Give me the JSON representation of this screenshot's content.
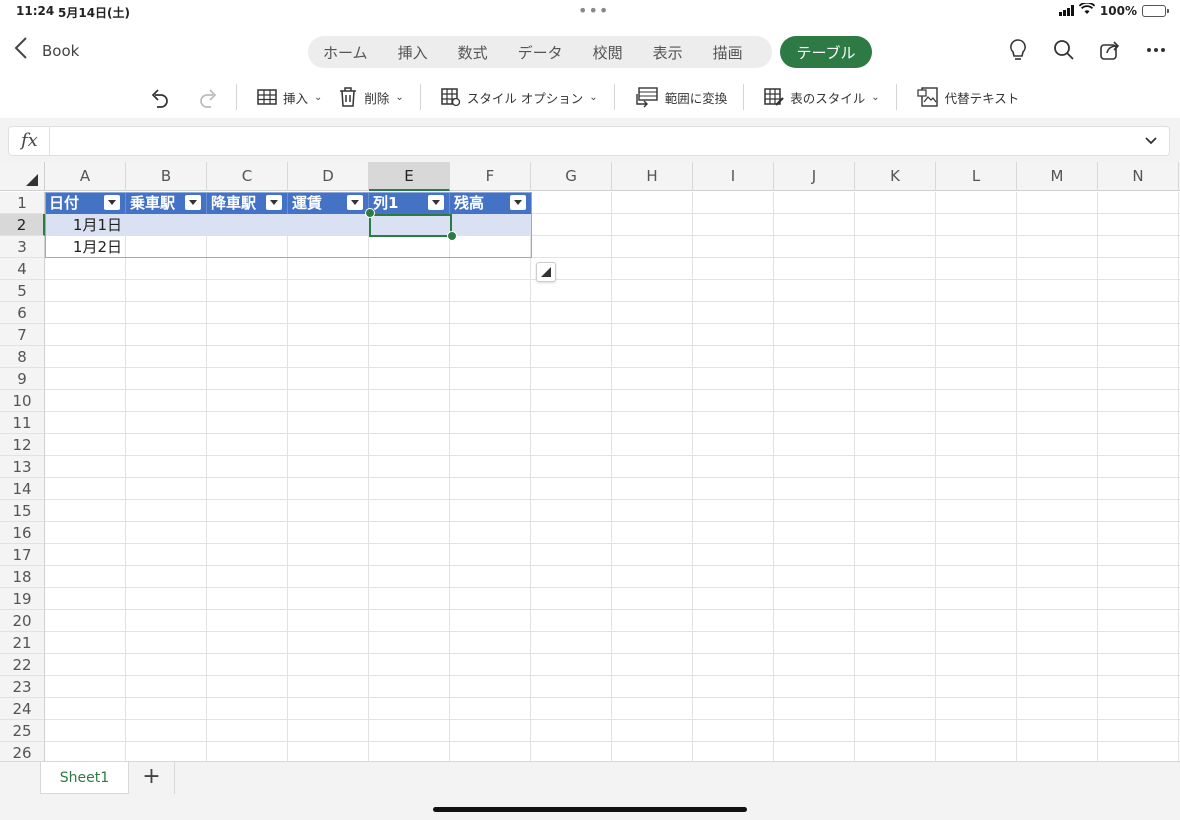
{
  "status": {
    "time": "11:24",
    "date": "5月14日(土)",
    "battery": "100%"
  },
  "nav": {
    "back_label": "Book"
  },
  "ribbon_tabs": [
    "ホーム",
    "挿入",
    "数式",
    "データ",
    "校閲",
    "表示",
    "描画"
  ],
  "active_tab": "テーブル",
  "toolbar": {
    "insert": "挿入",
    "delete": "削除",
    "style_options": "スタイル オプション",
    "convert_range": "範囲に変換",
    "table_style": "表のスタイル",
    "alt_text": "代替テキスト"
  },
  "formula_bar": {
    "fx": "fx",
    "value": ""
  },
  "columns": [
    "A",
    "B",
    "C",
    "D",
    "E",
    "F",
    "G",
    "H",
    "I",
    "J",
    "K",
    "L",
    "M",
    "N"
  ],
  "rows": [
    "1",
    "2",
    "3",
    "4",
    "5",
    "6",
    "7",
    "8",
    "9",
    "10",
    "11",
    "12",
    "13",
    "14",
    "15",
    "16",
    "17",
    "18",
    "19",
    "20",
    "21",
    "22",
    "23",
    "24",
    "25",
    "26"
  ],
  "selected_cell": {
    "column": "E",
    "row": "2"
  },
  "table": {
    "headers": [
      "日付",
      "乗車駅",
      "降車駅",
      "運賃",
      "列1",
      "残高"
    ],
    "rows": [
      [
        "1月1日",
        "",
        "",
        "",
        "",
        ""
      ],
      [
        "1月2日",
        "",
        "",
        "",
        "",
        ""
      ]
    ]
  },
  "sheets": [
    "Sheet1"
  ],
  "colors": {
    "accent": "#2e7a45",
    "table_header": "#4472c4",
    "table_band": "#d9e1f2"
  }
}
